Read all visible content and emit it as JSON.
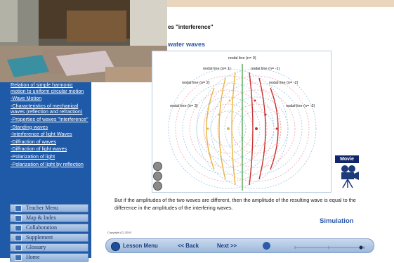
{
  "header": {
    "title": "es \"interference\"",
    "subtitle": "water waves"
  },
  "sidebar": {
    "links": [
      "Relation of simple harmonic motion to uniform circular motion",
      "-Wave Motion",
      "-Characteristics of mechanical waves (reflection and refraction)",
      "-Properties of waves \"interference\"",
      "-Standing waves",
      "-Interference of light Waves",
      "-Diffraction of waves",
      "-Diffraction of light waves",
      "-Polarization of light",
      "-Polarization of light by reflection"
    ],
    "menu": [
      "Teacher Menu",
      "Map & Index",
      "Collaboration",
      "Supplement",
      "Glossary",
      "Home"
    ]
  },
  "figure": {
    "labels": {
      "n0": "nodal line (n= 0)",
      "n1": "nodal line (n= 1)",
      "nm1": "nodal line (n= -1)",
      "n2": "nodal line (n= 2)",
      "nm2": "nodal line (n= -2)",
      "n3": "nodal line (n= 3)",
      "nm3": "nodal line (n= -3)"
    }
  },
  "movie_label": "Movie",
  "caption": "But if the amplitudes of the two waves are different, then the amplitude of the resulting wave is equal to the difference in the amplitudes of the interfering waves.",
  "simulation_label": "Simulation",
  "copyright": "Copyright (C) 2003",
  "navbar": {
    "lesson_menu": "Lesson Menu",
    "back": "<< Back",
    "next": "Next >>"
  },
  "colors": {
    "sidebar": "#1f5aa8",
    "accent": "#2a5aa8",
    "wave_left": "#e8b53b",
    "wave_right": "#c9302c"
  }
}
